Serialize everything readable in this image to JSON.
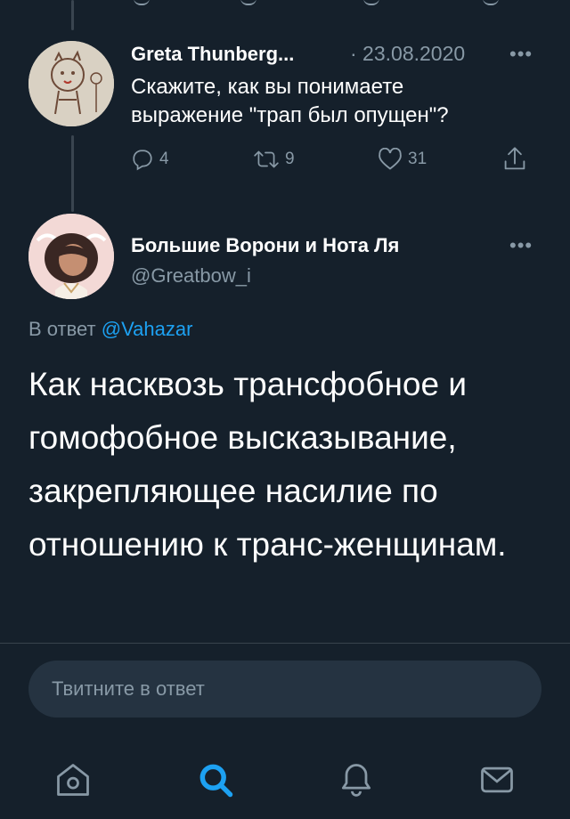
{
  "colors": {
    "background": "#15202b",
    "text_primary": "#ffffff",
    "text_secondary": "#8899a6",
    "accent": "#1da1f2",
    "divider": "#38444d",
    "input_bg": "#253341"
  },
  "parent_tweet": {
    "author_name": "Greta Thunberg...",
    "date": "· 23.08.2020",
    "more_icon": "ellipsis-icon",
    "text_line1": "Скажите, как вы понимаете",
    "text_line2": "выражение \"трап был опущен\"?",
    "reply_count": "4",
    "retweet_count": "9",
    "like_count": "31"
  },
  "main_tweet": {
    "author_name": "Большие Ворони и Нота Ля",
    "handle": "@Greatbow_i",
    "more_icon": "ellipsis-icon",
    "reply_prefix": "В ответ",
    "reply_mention": "@Vahazar",
    "text": "Как насквозь трансфобное и гомофобное высказывание, закрепляющее насилие по отношению к транс-женщинам."
  },
  "reply_input": {
    "placeholder": "Твитните в ответ"
  },
  "tab_bar": {
    "items": [
      "home-icon",
      "search-icon",
      "notifications-icon",
      "messages-icon"
    ],
    "active": "search-icon"
  }
}
